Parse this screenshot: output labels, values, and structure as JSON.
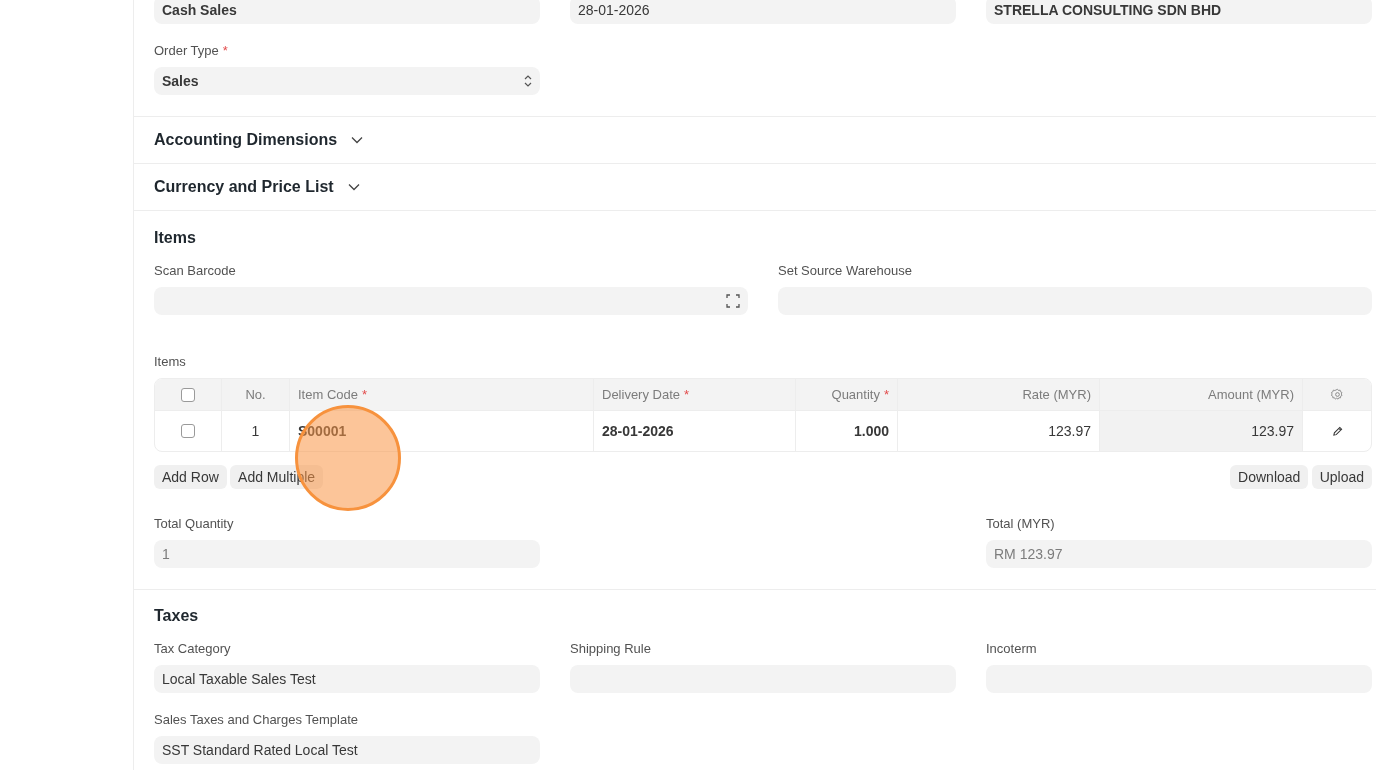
{
  "top_fields": [
    {
      "value": "Cash Sales",
      "bold": true
    },
    {
      "value": "28-01-2026",
      "bold": false
    },
    {
      "value": "STRELLA CONSULTING SDN BHD",
      "bold": true
    }
  ],
  "order_type": {
    "label": "Order Type",
    "required_mark": "*",
    "value": "Sales",
    "bold": true
  },
  "sections": [
    {
      "title": "Accounting Dimensions",
      "collapsible": true
    },
    {
      "title": "Currency and Price List",
      "collapsible": true
    }
  ],
  "items_section": {
    "title": "Items",
    "fields": [
      {
        "label": "Scan Barcode",
        "kind": "barcode"
      },
      {
        "label": "Set Source Warehouse",
        "kind": "text"
      }
    ],
    "table_label": "Items",
    "table": {
      "select_all_checked": false,
      "columns": [
        {
          "label": "No."
        },
        {
          "label": "Item Code",
          "required_mark": "*"
        },
        {
          "label": "Delivery Date",
          "required_mark": "*"
        },
        {
          "label": "Quantity",
          "required_mark": "*"
        },
        {
          "label": "Rate (MYR)"
        },
        {
          "label": "Amount (MYR)"
        }
      ],
      "rows": [
        {
          "checked": false,
          "cells": [
            {
              "text": "1",
              "bold": false,
              "read_only": false
            },
            {
              "text": "S00001",
              "bold": true,
              "read_only": false
            },
            {
              "text": "28-01-2026",
              "bold": true,
              "read_only": false
            },
            {
              "text": "1.000",
              "bold": true,
              "read_only": false
            },
            {
              "text": "123.97",
              "bold": false,
              "read_only": false
            },
            {
              "text": "123.97",
              "bold": false,
              "read_only": true
            }
          ]
        }
      ]
    },
    "left_buttons": [
      "Add Row",
      "Add Multiple"
    ],
    "right_buttons": [
      "Download",
      "Upload"
    ],
    "totals": [
      {
        "label": "Total Quantity",
        "value": "1",
        "read_only": true
      },
      {
        "label": "Total (MYR)",
        "value": "RM 123.97",
        "read_only": true
      }
    ]
  },
  "taxes_section": {
    "title": "Taxes",
    "fields": [
      {
        "label": "Tax Category",
        "value": "Local Taxable Sales Test"
      },
      {
        "label": "Shipping Rule"
      },
      {
        "label": "Incoterm"
      },
      {
        "label": "Sales Taxes and Charges Template",
        "value": "SST Standard Rated Local Test"
      }
    ]
  }
}
